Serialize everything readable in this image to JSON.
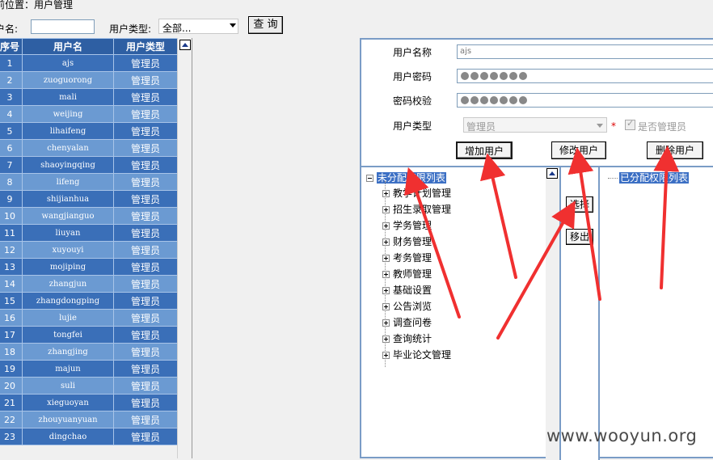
{
  "breadcrumb": "前位置：用户管理",
  "search": {
    "user_label": "户名:",
    "name_value": "",
    "type_label": "用户类型:",
    "type_value": "全部...",
    "query_label": "查 询"
  },
  "table": {
    "headers": [
      "序号",
      "用户名",
      "用户类型"
    ],
    "rows": [
      [
        "1",
        "ajs",
        "管理员"
      ],
      [
        "2",
        "zuoguorong",
        "管理员"
      ],
      [
        "3",
        "mali",
        "管理员"
      ],
      [
        "4",
        "weijing",
        "管理员"
      ],
      [
        "5",
        "lihaifeng",
        "管理员"
      ],
      [
        "6",
        "chenyalan",
        "管理员"
      ],
      [
        "7",
        "shaoyingqing",
        "管理员"
      ],
      [
        "8",
        "lifeng",
        "管理员"
      ],
      [
        "9",
        "shijianhua",
        "管理员"
      ],
      [
        "10",
        "wangjianguo",
        "管理员"
      ],
      [
        "11",
        "liuyan",
        "管理员"
      ],
      [
        "12",
        "xuyouyi",
        "管理员"
      ],
      [
        "13",
        "mojiping",
        "管理员"
      ],
      [
        "14",
        "zhangjun",
        "管理员"
      ],
      [
        "15",
        "zhangdongping",
        "管理员"
      ],
      [
        "16",
        "lujie",
        "管理员"
      ],
      [
        "17",
        "tongfei",
        "管理员"
      ],
      [
        "18",
        "zhangjing",
        "管理员"
      ],
      [
        "19",
        "majun",
        "管理员"
      ],
      [
        "20",
        "suli",
        "管理员"
      ],
      [
        "21",
        "xieguoyan",
        "管理员"
      ],
      [
        "22",
        "zhouyuanyuan",
        "管理员"
      ],
      [
        "23",
        "dingchao",
        "管理员"
      ]
    ]
  },
  "form": {
    "name_label": "用户名称",
    "name_value": "ajs",
    "password_label": "用户密码",
    "confirm_label": "密码校验",
    "type_label": "用户类型",
    "type_value": "管理员",
    "required_mark": "*",
    "admin_label": "是否管理员",
    "add_label": "增加用户",
    "edit_label": "修改用户",
    "delete_label": "删除用户"
  },
  "permissions": {
    "unassigned_title": "未分配权限列表",
    "assigned_title": "已分配权限列表",
    "select_label": "选择",
    "remove_label": "移出",
    "items": [
      "教学计划管理",
      "招生录取管理",
      "学务管理",
      "财务管理",
      "考务管理",
      "教师管理",
      "基础设置",
      "公告浏览",
      "调查问卷",
      "查询统计",
      "毕业论文管理"
    ]
  },
  "watermark": "www.wooyun.org",
  "colors": {
    "header_blue": "#2e5fa3",
    "row_dark": "#3a6fb8",
    "row_light": "#6b9ad2",
    "arrow_red": "#f03030"
  }
}
